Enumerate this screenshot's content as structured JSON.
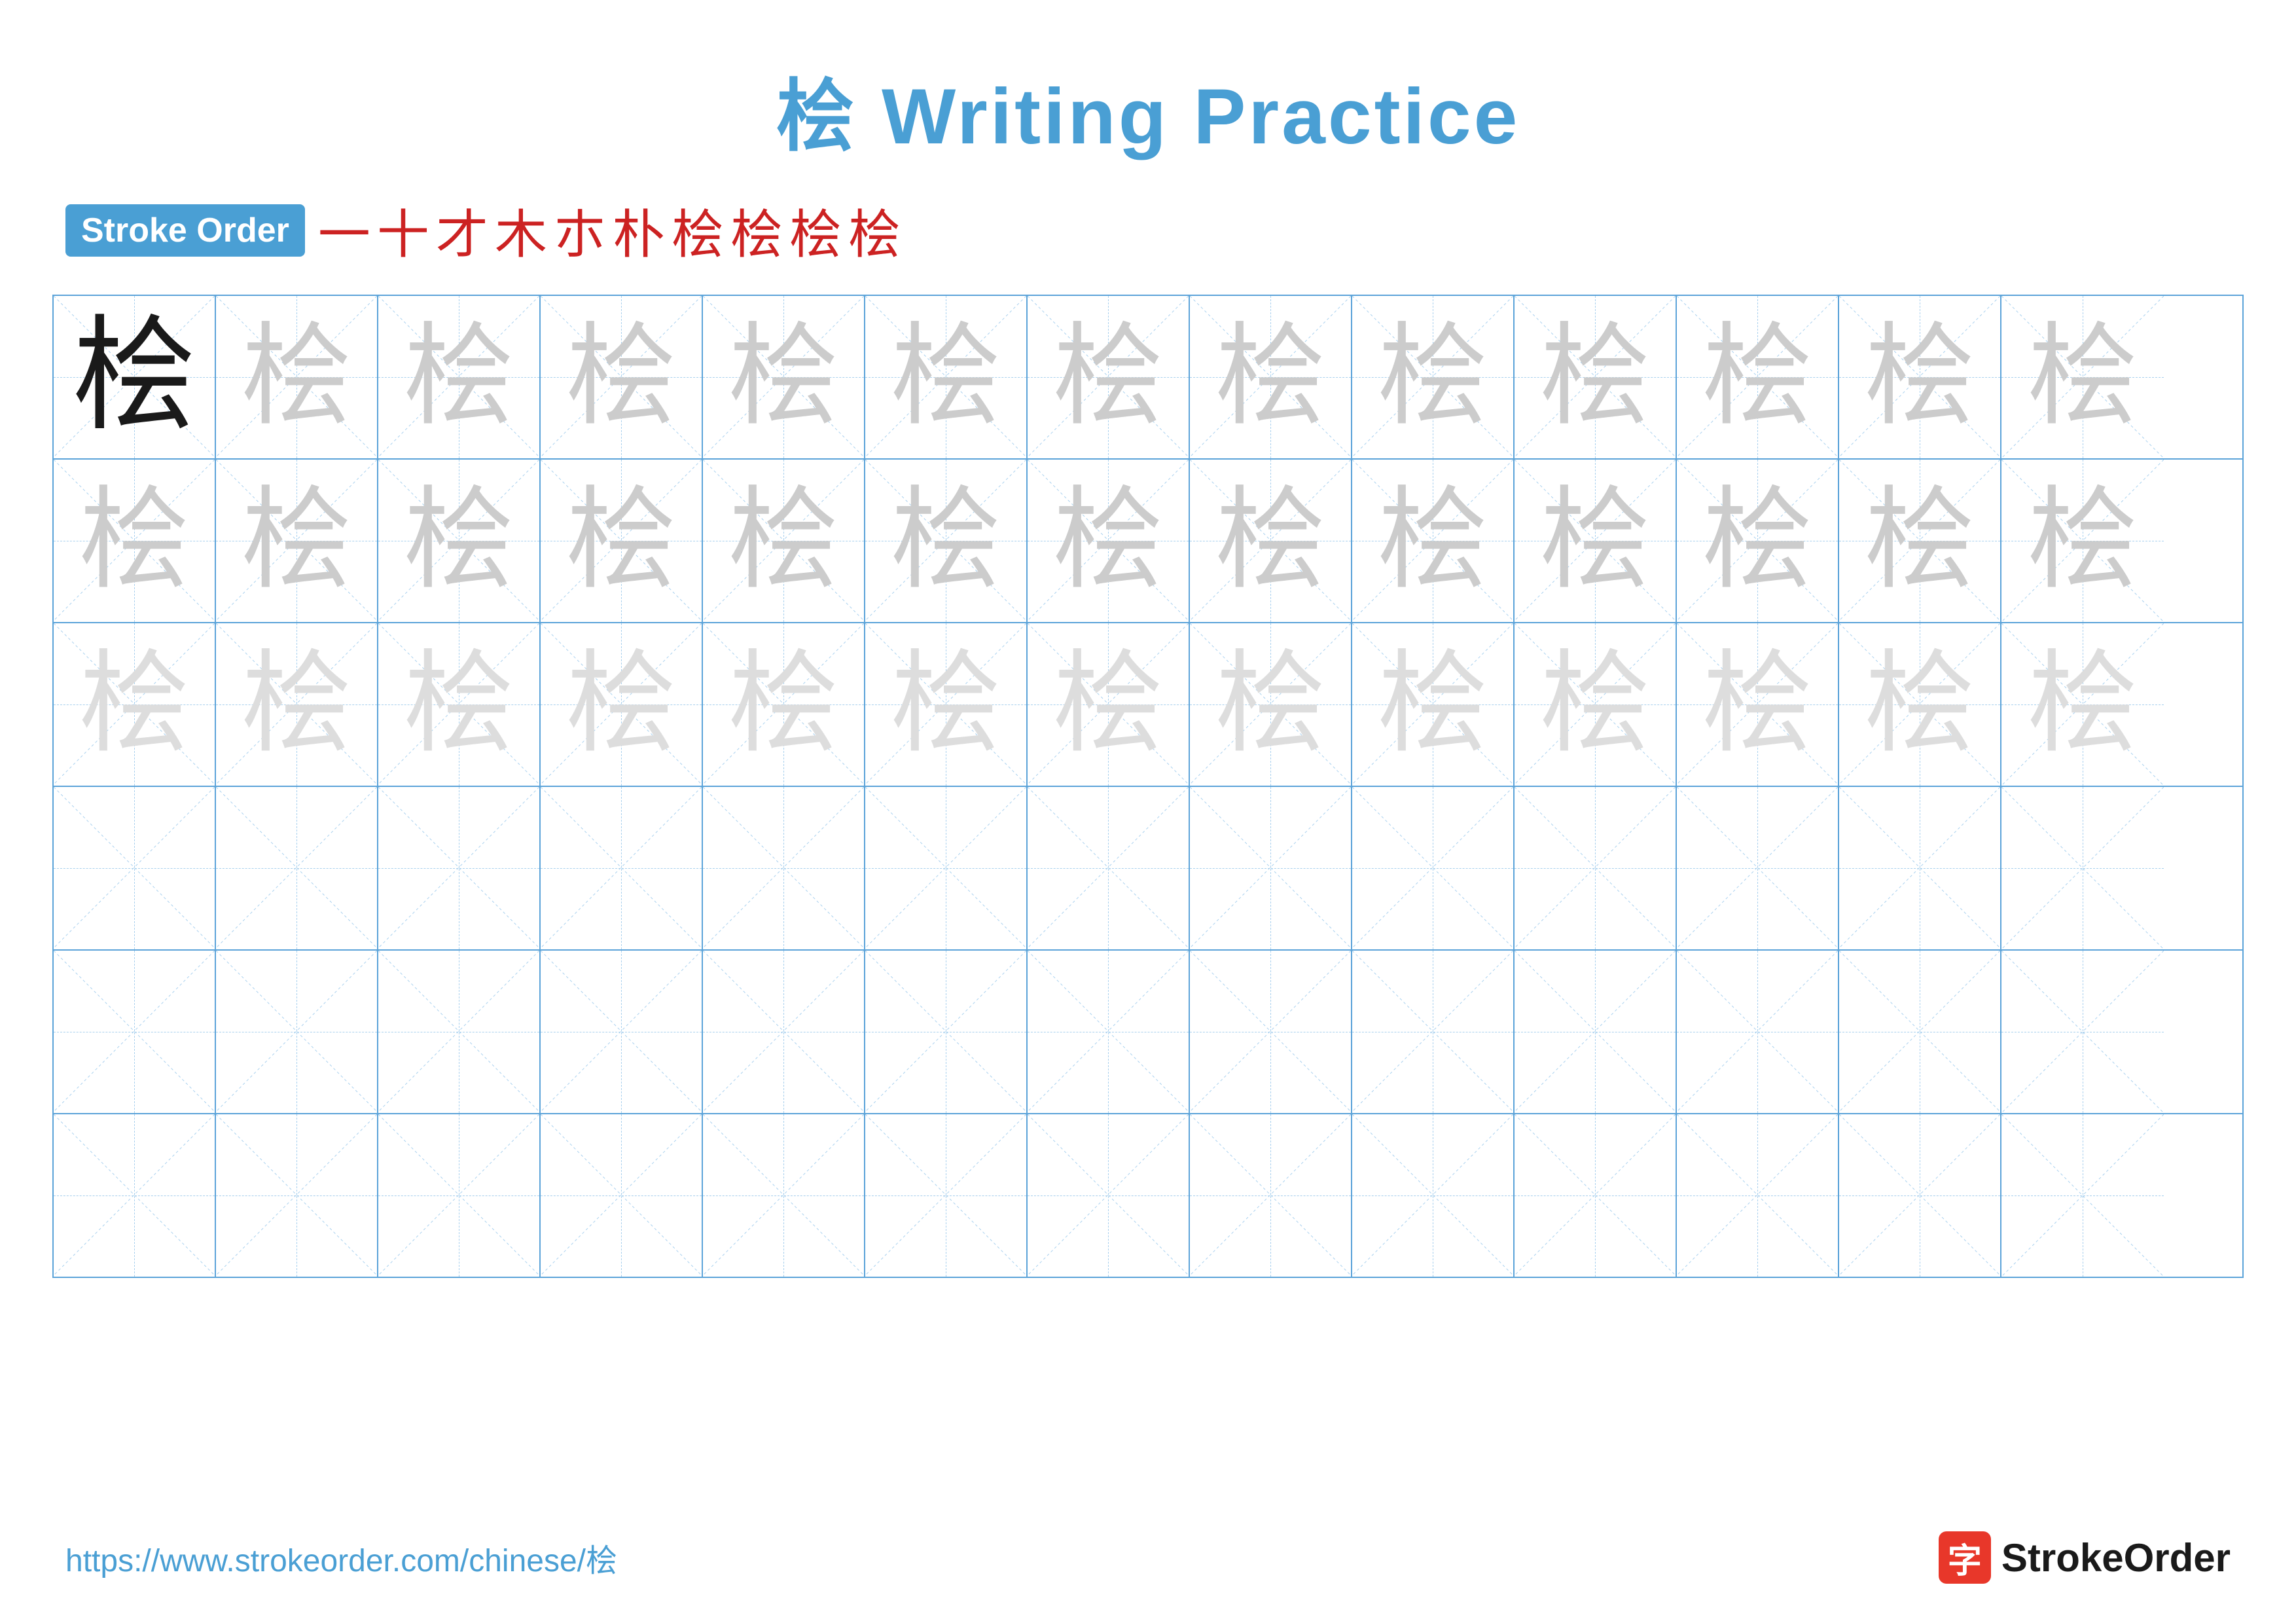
{
  "title": "桧 Writing Practice",
  "stroke_order": {
    "badge_label": "Stroke Order",
    "strokes": [
      "一",
      "十",
      "才",
      "木",
      "朩",
      "朴",
      "桧",
      "桧",
      "桧",
      "桧"
    ]
  },
  "character": "桧",
  "grid": {
    "cols": 13,
    "rows": 6,
    "row_configs": [
      {
        "type": "guide_first"
      },
      {
        "type": "guide_all"
      },
      {
        "type": "guide_all"
      },
      {
        "type": "empty"
      },
      {
        "type": "empty"
      },
      {
        "type": "empty"
      }
    ]
  },
  "footer": {
    "url": "https://www.strokeorder.com/chinese/桧",
    "logo_char": "字",
    "logo_label": "StrokeOrder"
  }
}
